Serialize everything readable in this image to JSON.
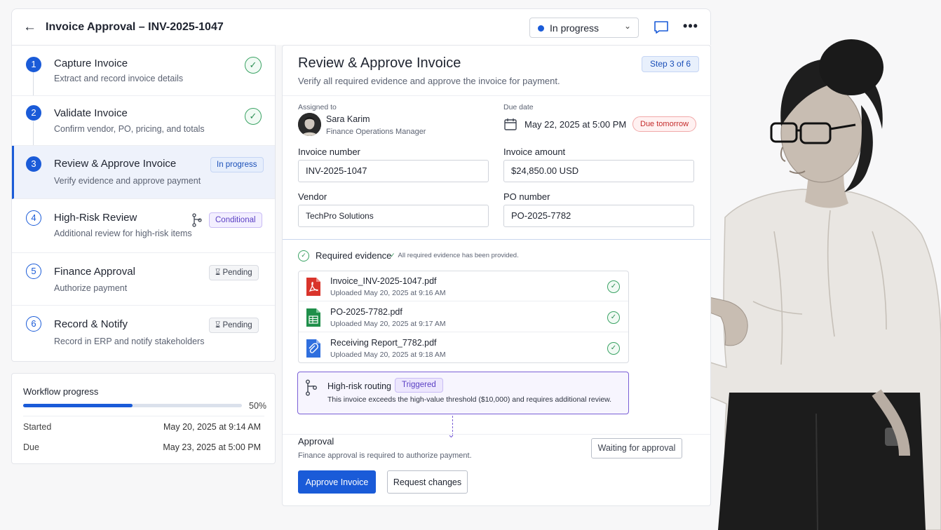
{
  "header": {
    "back_icon": "arrow-left-icon",
    "title": "Invoice Approval – INV-2025-1047",
    "status": "In progress",
    "status_color": "#1a5bd8",
    "comment_icon": "chat-bubble-icon",
    "more_icon": "more-horizontal-icon",
    "more_glyph": "•••"
  },
  "steps": [
    {
      "num": "1",
      "name": "Capture Invoice",
      "desc": "Extract and record invoice details",
      "state": "complete"
    },
    {
      "num": "2",
      "name": "Validate Invoice",
      "desc": "Confirm vendor, PO, pricing, and totals",
      "state": "complete"
    },
    {
      "num": "3",
      "name": "Review & Approve Invoice",
      "desc": "Verify evidence and approve payment",
      "state": "active",
      "badge": "In progress"
    },
    {
      "num": "4",
      "name": "High-Risk Review",
      "desc": "Additional review for high-risk items",
      "state": "conditional",
      "badge": "Conditional"
    },
    {
      "num": "5",
      "name": "Finance Approval",
      "desc": "Authorize payment",
      "state": "pending",
      "badge": "Pending"
    },
    {
      "num": "6",
      "name": "Record & Notify",
      "desc": "Record in ERP and notify stakeholders",
      "state": "pending",
      "badge": "Pending"
    }
  ],
  "progress": {
    "title": "Workflow progress",
    "percent_label": "50%",
    "percent_value": 0.5,
    "started_label": "Started",
    "started_value": "May 20, 2025 at 9:14 AM",
    "due_label": "Due",
    "due_value": "May 23, 2025 at 5:00 PM"
  },
  "main": {
    "title": "Review & Approve Invoice",
    "subtitle": "Verify all required evidence and approve the invoice for payment.",
    "step_badge": "Step 3 of 6",
    "assigned_label": "Assigned to",
    "assignee_name": "Sara Karim",
    "assignee_role": "Finance Operations Manager",
    "due_label": "Due date",
    "due_date": "May 22, 2025 at 5:00 PM",
    "due_badge": "Due tomorrow",
    "invoice_number_label": "Invoice number",
    "invoice_number": "INV-2025-1047",
    "invoice_amount_label": "Invoice amount",
    "invoice_amount": "$24,850.00 USD",
    "vendor_label": "Vendor",
    "vendor": "TechPro Solutions",
    "po_label": "PO number",
    "po_number": "PO-2025-7782"
  },
  "evidence": {
    "title": "Required evidence",
    "note": "All required evidence has been provided.",
    "files": [
      {
        "name": "Invoice_INV-2025-1047.pdf",
        "meta": "Uploaded May 20, 2025 at 9:16 AM",
        "icon": "pdf-file-icon"
      },
      {
        "name": "PO-2025-7782.pdf",
        "meta": "Uploaded May 20, 2025 at 9:17 AM",
        "icon": "spreadsheet-file-icon"
      },
      {
        "name": "Receiving Report_7782.pdf",
        "meta": "Uploaded May 20, 2025 at 9:18 AM",
        "icon": "attachment-file-icon"
      }
    ]
  },
  "routing": {
    "title": "High-risk routing",
    "badge": "Triggered",
    "desc": "This invoice exceeds the high-value threshold ($10,000) and requires additional review."
  },
  "approval": {
    "title": "Approval",
    "desc": "Finance approval is required to authorize payment.",
    "waiting": "Waiting for approval",
    "approve_label": "Approve Invoice",
    "request_label": "Request changes"
  },
  "colors": {
    "accent": "#1a5bd8",
    "success": "#3aa364",
    "conditional": "#7a5fd6",
    "danger": "#c42b2b"
  }
}
